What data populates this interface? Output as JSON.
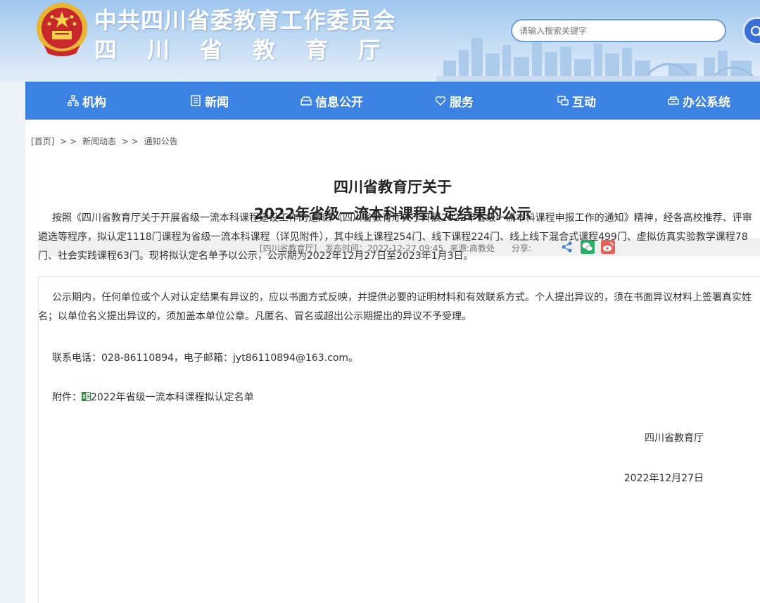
{
  "header": {
    "title_line1": "中共四川省委教育工作委员会",
    "title_line2": "四川省教育厅",
    "search_placeholder": "请输入搜索关键字"
  },
  "nav": [
    {
      "label": "机构",
      "icon": "org-icon"
    },
    {
      "label": "新闻",
      "icon": "news-icon"
    },
    {
      "label": "信息公开",
      "icon": "info-public-icon"
    },
    {
      "label": "服务",
      "icon": "service-icon"
    },
    {
      "label": "互动",
      "icon": "interaction-icon"
    },
    {
      "label": "办公系统",
      "icon": "office-icon"
    }
  ],
  "breadcrumb": {
    "home": "[首页]",
    "sep": "> >",
    "level1": "新闻动态",
    "level2": "通知公告"
  },
  "article": {
    "title_line1": "四川省教育厅关于",
    "title_line2": "2022年省级一流本科课程认定结果的公示",
    "source": "[四川省教育厅]",
    "publish_time": "发布时间：2022-12-27 09:45",
    "origin": "来源:高教处",
    "share_label": "分享:",
    "para1": "按照《四川省教育厅关于开展省级一流本科课程建设工作的通知》《四川省教育厅关于开展2022年省级一流本科课程申报工作的通知》精神，经各高校推荐、评审遴选等程序，拟认定1118门课程为省级一流本科课程（详见附件），其中线上课程254门、线下课程224门、线上线下混合式课程499门、虚拟仿真实验教学课程78门、社会实践课程63门。现将拟认定名单予以公示，公示期为2022年12月27日至2023年1月3日。",
    "para2": "公示期内，任何单位或个人对认定结果有异议的，应以书面方式反映，并提供必要的证明材料和有效联系方式。个人提出异议的，须在书面异议材料上签署真实姓名；以单位名义提出异议的，须加盖本单位公章。凡匿名、冒名或超出公示期提出的异议不予受理。",
    "contact": "联系电话：028-86110894，电子邮箱：jyt86110894@163.com。",
    "attachment_label": "附件：",
    "attachment_name": "2022年省级一流本科课程拟认定名单",
    "signature": "四川省教育厅",
    "date": "2022年12月27日"
  },
  "colors": {
    "nav_bg": "#3b82e2",
    "wechat": "#2aae67",
    "weibo": "#e6625a",
    "share": "#3f7fd6"
  }
}
